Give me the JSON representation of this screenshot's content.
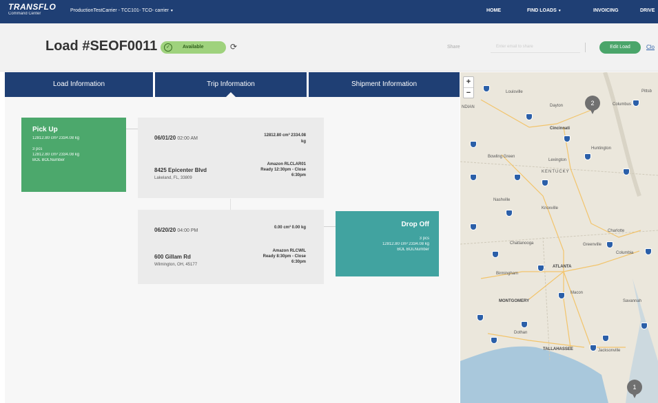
{
  "app": {
    "logo_name": "TRANSFLO",
    "logo_sub": "Command Center",
    "carrier_selector": "ProductionTestCarrier - TCC101- TCO- carrier"
  },
  "nav": {
    "home": "HOME",
    "find_loads": "FIND LOADS",
    "invoicing": "INVOICING",
    "drivers": "DRIVE"
  },
  "header": {
    "load_title": "Load #SEOF0011",
    "status": "Available",
    "share_label": "Share",
    "share_placeholder": "Enter email to share",
    "edit_button": "Edit Load",
    "close_link": "Clo"
  },
  "tabs": [
    {
      "label": "Load Information"
    },
    {
      "label": "Trip Information"
    },
    {
      "label": "Shipment Information"
    }
  ],
  "pickup_card": {
    "title": "Pick Up",
    "line1": "12812.80 cm³  2334.08 kg",
    "line2": "3 pcs",
    "line3": "12812.80 cm³  2334.08 kg",
    "line4": "BOL BOLNumber"
  },
  "dropoff_card": {
    "title": "Drop Off",
    "line1": "3 pcs",
    "line2": "12812.80 cm³  2334.08 kg",
    "line3": "BOL BOLNumber"
  },
  "stops": [
    {
      "date": "06/01/20",
      "time": "02:00 AM",
      "measure_line1": "12812.80 cm³  2334.08",
      "measure_line2": "kg",
      "street": "8425 Epicenter Blvd",
      "city": "Lakeland, FL, 33809",
      "ready_line1": "Amazon RLCLAR01",
      "ready_line2": "Ready 12:30pm - Close",
      "ready_line3": "6:30pm"
    },
    {
      "date": "06/20/20",
      "time": "04:00 PM",
      "measure_line1": "0.00 cm³  0.00 kg",
      "measure_line2": "",
      "street": "600 Gillam Rd",
      "city": "Wilmington, OH, 45177",
      "ready_line1": "Amazon RLCWIL",
      "ready_line2": "Ready 8:30pm - Close",
      "ready_line3": "6:30pm"
    }
  ],
  "map": {
    "zoom_in": "+",
    "zoom_out": "−",
    "pins": [
      {
        "label": "2"
      },
      {
        "label": "1"
      }
    ],
    "cities": {
      "louisville": "Louisville",
      "cincinnati": "Cincinnati",
      "huntington": "Huntington",
      "pittsburgh": "Pittsb",
      "kentucky": "KENTUCKY",
      "knoxville": "Knoxville",
      "charlotte": "Charlotte",
      "atlanta": "ATLANTA",
      "birmingham": "Birmingham",
      "montgomery": "MONTGOMERY",
      "tallahassee": "TALLAHASSEE",
      "jacksonville": "Jacksonville",
      "columbus": "Columbus",
      "indianapolis": "NDIAN",
      "nashville": "Nashville",
      "chattanooga": "Chattanooga",
      "dayton": "Dayton",
      "lexington": "Lexington",
      "bowling_green": "Bowling Green",
      "macon": "Macon",
      "savannah": "Savannah",
      "greenville": "Greenville",
      "columbia": "Columbia",
      "dothan": "Dothan"
    }
  }
}
